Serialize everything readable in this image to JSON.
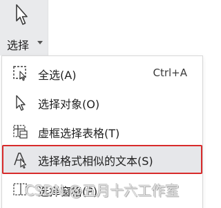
{
  "ribbon": {
    "select_label": "选择",
    "icon": "cursor-arrow-icon",
    "caret_icon": "caret-down-icon"
  },
  "menu": {
    "items": [
      {
        "label": "全选(A)",
        "shortcut": "Ctrl+A",
        "icon": "select-all-dashed-icon"
      },
      {
        "label": "选择对象(O)",
        "shortcut": "",
        "icon": "cursor-arrow-icon"
      },
      {
        "label": "虚框选择表格(T)",
        "shortcut": "",
        "icon": "dashed-table-icon"
      },
      {
        "label": "选择格式相似的文本(S)",
        "shortcut": "",
        "icon": "similar-format-text-icon"
      },
      {
        "label": "选择窗格(P)",
        "shortcut": "",
        "icon": "selection-pane-icon"
      }
    ]
  },
  "watermark": "CSDN @五月十六工作室",
  "colors": {
    "ribbon_bg": "#e9eaec",
    "highlight_bg": "#e6e7ea",
    "highlight_border": "#d82a2a"
  }
}
